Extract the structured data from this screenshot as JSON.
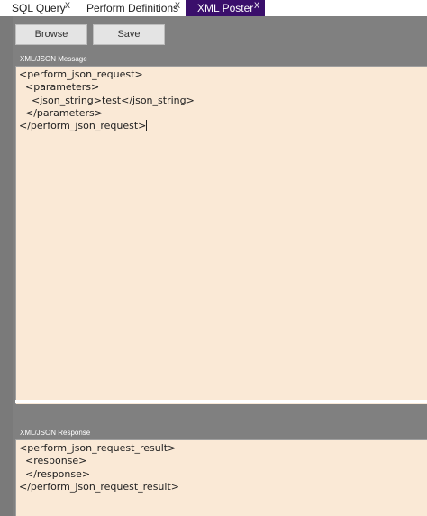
{
  "tabs": [
    {
      "label": "SQL Query",
      "close": "X",
      "active": false
    },
    {
      "label": "Perform Definitions",
      "close": "X",
      "active": false
    },
    {
      "label": "XML Poster",
      "close": "X",
      "active": true
    }
  ],
  "toolbar": {
    "browse_label": "Browse",
    "save_label": "Save"
  },
  "message": {
    "label": "XML/JSON Message",
    "lines": [
      "<perform_json_request>",
      "  <parameters>",
      "    <json_string>test</json_string>",
      "  </parameters>",
      "</perform_json_request>"
    ]
  },
  "response": {
    "label": "XML/JSON Response",
    "lines": [
      "<perform_json_request_result>",
      "  <response>",
      "  </response>",
      "</perform_json_request_result>"
    ]
  },
  "colors": {
    "active_tab": "#3a0f6b",
    "editor_bg": "#fae9d6",
    "panel_bg": "#808080"
  }
}
